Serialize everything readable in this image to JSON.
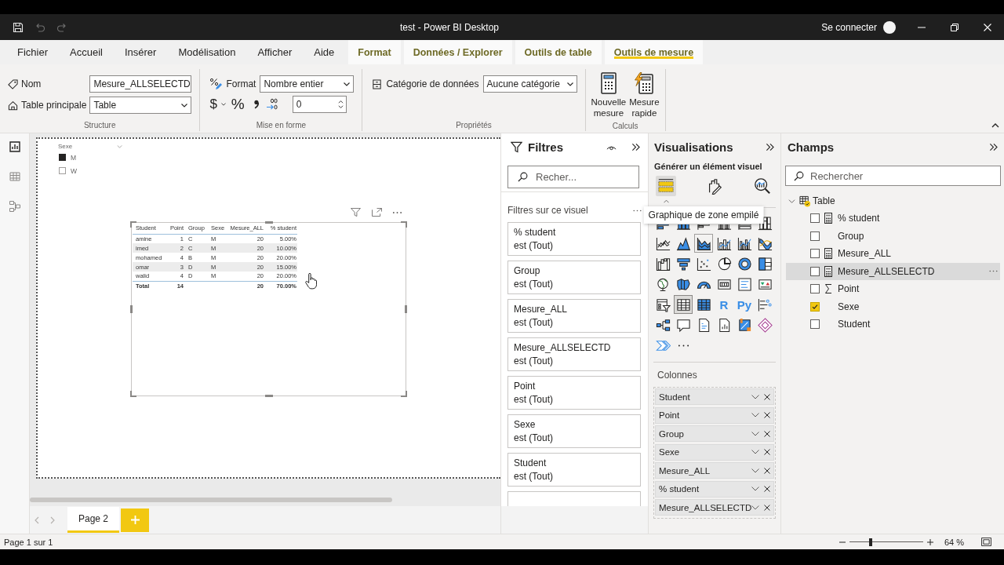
{
  "window": {
    "title": "test - Power BI Desktop",
    "account": "Se connecter",
    "quick_access": [
      {
        "kind": "save",
        "disabled": false
      },
      {
        "kind": "undo",
        "disabled": true
      },
      {
        "kind": "redo",
        "disabled": true
      }
    ]
  },
  "ribbon_tabs": [
    {
      "label": "Fichier",
      "kind": "standard",
      "selected": false
    },
    {
      "label": "Accueil",
      "kind": "standard",
      "selected": false
    },
    {
      "label": "Insérer",
      "kind": "standard",
      "selected": false
    },
    {
      "label": "Modélisation",
      "kind": "standard",
      "selected": false
    },
    {
      "label": "Afficher",
      "kind": "standard",
      "selected": false
    },
    {
      "label": "Aide",
      "kind": "standard",
      "selected": false
    },
    {
      "label": "Format",
      "kind": "contextual",
      "selected": false
    },
    {
      "label": "Données / Explorer",
      "kind": "contextual",
      "selected": false
    },
    {
      "label": "Outils de table",
      "kind": "contextual",
      "selected": false
    },
    {
      "label": "Outils de mesure",
      "kind": "contextual",
      "selected": true
    }
  ],
  "ribbon": {
    "structure": {
      "title": "Structure",
      "name_label": "Nom",
      "name_value": "Mesure_ALLSELECTD",
      "home_table_label": "Table principale",
      "home_table_value": "Table"
    },
    "formatting": {
      "title": "Mise en forme",
      "format_label": "Format",
      "format_value": "Nombre entier",
      "currency_symbol": "$",
      "percent_symbol": "%",
      "decimal_places_value": "0"
    },
    "properties": {
      "title": "Propriétés",
      "category_label": "Catégorie de données",
      "category_value": "Aucune catégorie"
    },
    "calculations": {
      "title": "Calculs",
      "buttons": [
        {
          "kind": "new",
          "label": "Nouvelle mesure"
        },
        {
          "kind": "quick",
          "label": "Mesure rapide"
        }
      ]
    }
  },
  "views": [
    {
      "kind": "report",
      "selected": true
    },
    {
      "kind": "data",
      "selected": false
    },
    {
      "kind": "model",
      "selected": false
    }
  ],
  "canvas": {
    "slicer": {
      "title": "Sexe",
      "items": [
        {
          "label": "M",
          "checked": true
        },
        {
          "label": "W",
          "checked": false
        }
      ]
    },
    "table_visual": {
      "columns": [
        "Student",
        "Point",
        "Group",
        "Sexe",
        "Mesure_ALL",
        "% student"
      ],
      "rows": [
        [
          "amine",
          "1",
          "C",
          "M",
          "20",
          "5.00%"
        ],
        [
          "imed",
          "2",
          "C",
          "M",
          "20",
          "10.00%"
        ],
        [
          "mohamed",
          "4",
          "B",
          "M",
          "20",
          "20.00%"
        ],
        [
          "omar",
          "3",
          "D",
          "M",
          "20",
          "15.00%"
        ],
        [
          "walid",
          "4",
          "D",
          "M",
          "20",
          "20.00%"
        ]
      ],
      "total": {
        "label": "Total",
        "point": "14",
        "mesure_all": "20",
        "percent": "70.00%"
      }
    },
    "pages": [
      {
        "label": "Page 2",
        "selected": true
      }
    ]
  },
  "filters": {
    "title": "Filtres",
    "search_placeholder": "Recher...",
    "section": "Filtres sur ce visuel",
    "cards": [
      {
        "field": "% student",
        "condition": "est (Tout)"
      },
      {
        "field": "Group",
        "condition": "est (Tout)"
      },
      {
        "field": "Mesure_ALL",
        "condition": "est (Tout)"
      },
      {
        "field": "Mesure_ALLSELECTD",
        "condition": "est (Tout)"
      },
      {
        "field": "Point",
        "condition": "est (Tout)"
      },
      {
        "field": "Sexe",
        "condition": "est (Tout)"
      },
      {
        "field": "Student",
        "condition": "est (Tout)"
      }
    ]
  },
  "visualizations": {
    "title": "Visualisations",
    "subtitle": "Générer un élément visuel",
    "modes": [
      {
        "kind": "build",
        "selected": true
      },
      {
        "kind": "format",
        "selected": false
      },
      {
        "kind": "analytics",
        "selected": false
      }
    ],
    "gallery": [
      {
        "kind": "stacked_bar",
        "selected": false
      },
      {
        "kind": "stacked_column",
        "selected": false
      },
      {
        "kind": "clustered_bar",
        "selected": false
      },
      {
        "kind": "clustered_column",
        "selected": false
      },
      {
        "kind": "stacked_bar_100",
        "selected": false
      },
      {
        "kind": "stacked_column_100",
        "selected": false
      },
      {
        "kind": "line",
        "selected": false
      },
      {
        "kind": "area",
        "selected": false
      },
      {
        "kind": "stacked_area",
        "selected": false,
        "tooltip": "Graphique de zone empilé"
      },
      {
        "kind": "line_stacked_column",
        "selected": false
      },
      {
        "kind": "line_clustered_column",
        "selected": false
      },
      {
        "kind": "ribbon",
        "selected": false
      },
      {
        "kind": "waterfall",
        "selected": false
      },
      {
        "kind": "funnel",
        "selected": false
      },
      {
        "kind": "scatter",
        "selected": false
      },
      {
        "kind": "pie",
        "selected": false
      },
      {
        "kind": "donut",
        "selected": false
      },
      {
        "kind": "treemap",
        "selected": false
      },
      {
        "kind": "map",
        "selected": false
      },
      {
        "kind": "filled_map",
        "selected": false
      },
      {
        "kind": "gauge",
        "selected": false
      },
      {
        "kind": "card",
        "selected": false
      },
      {
        "kind": "multi_row_card",
        "selected": false
      },
      {
        "kind": "kpi",
        "selected": false
      },
      {
        "kind": "slicer",
        "selected": false
      },
      {
        "kind": "table",
        "selected": true
      },
      {
        "kind": "matrix",
        "selected": false
      },
      {
        "kind": "r_script",
        "selected": false,
        "label": "R"
      },
      {
        "kind": "python",
        "selected": false,
        "label": "Py"
      },
      {
        "kind": "key_influencers",
        "selected": false
      },
      {
        "kind": "decomposition_tree",
        "selected": false
      },
      {
        "kind": "qa",
        "selected": false
      },
      {
        "kind": "smart_narrative",
        "selected": false
      },
      {
        "kind": "paginated",
        "selected": false
      },
      {
        "kind": "map_tile",
        "selected": false
      },
      {
        "kind": "diamond",
        "selected": false
      },
      {
        "kind": "chevrons",
        "selected": false
      },
      {
        "kind": "more",
        "selected": false
      }
    ],
    "wells_title": "Colonnes",
    "wells": [
      "Student",
      "Point",
      "Group",
      "Sexe",
      "Mesure_ALL",
      "% student",
      "Mesure_ALLSELECTD"
    ]
  },
  "fields": {
    "title": "Champs",
    "search_placeholder": "Rechercher",
    "tables": [
      {
        "name": "Table",
        "expanded": true,
        "in_use": true,
        "children": [
          {
            "name": "% student",
            "kind": "measure",
            "checked": false,
            "selected": false
          },
          {
            "name": "Group",
            "kind": "column",
            "checked": false,
            "selected": false
          },
          {
            "name": "Mesure_ALL",
            "kind": "measure",
            "checked": false,
            "selected": false
          },
          {
            "name": "Mesure_ALLSELECTD",
            "kind": "measure",
            "checked": false,
            "selected": true
          },
          {
            "name": "Point",
            "kind": "sum",
            "checked": false,
            "selected": false
          },
          {
            "name": "Sexe",
            "kind": "column",
            "checked": true,
            "selected": false
          },
          {
            "name": "Student",
            "kind": "column",
            "checked": false,
            "selected": false
          }
        ]
      }
    ]
  },
  "status_bar": {
    "page_info": "Page 1 sur 1",
    "zoom": {
      "level": 0.29,
      "reading": "64 %"
    }
  }
}
